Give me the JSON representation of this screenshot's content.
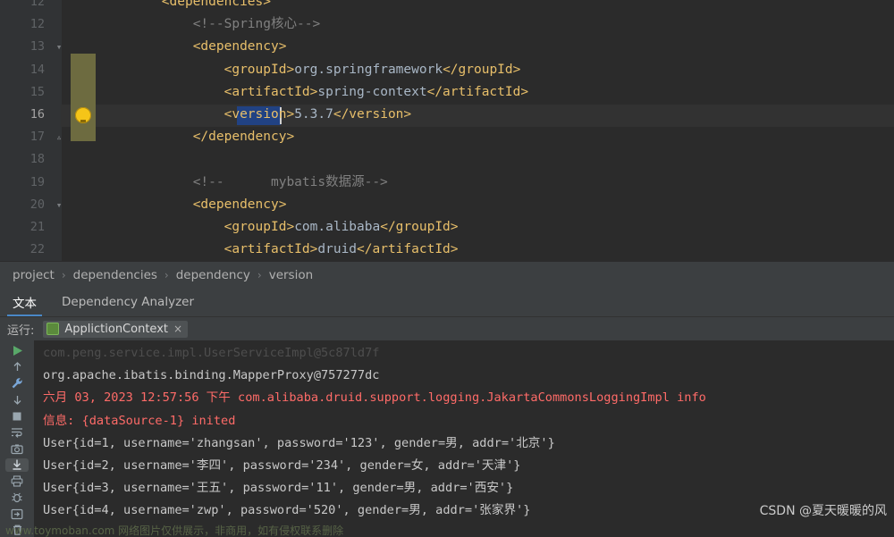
{
  "editor": {
    "lines": [
      {
        "num": "12",
        "fold": "",
        "indent": 12,
        "tokens": [
          {
            "t": "tag",
            "v": "&lt;dependencies&gt;"
          }
        ],
        "current": false
      },
      {
        "num": "12",
        "fold": "",
        "indent": 16,
        "tokens": [
          {
            "t": "cmt",
            "v": "&lt;!--Spring核心--&gt;"
          }
        ],
        "current": false
      },
      {
        "num": "13",
        "fold": "v",
        "indent": 16,
        "tokens": [
          {
            "t": "tag",
            "v": "&lt;dependency&gt;"
          }
        ],
        "current": false
      },
      {
        "num": "14",
        "fold": "",
        "indent": 20,
        "tokens": [
          {
            "t": "tag",
            "v": "&lt;groupId&gt;"
          },
          {
            "t": "txt",
            "v": "org.springframework"
          },
          {
            "t": "tag",
            "v": "&lt;/groupId&gt;"
          }
        ],
        "current": false
      },
      {
        "num": "15",
        "fold": "",
        "indent": 20,
        "tokens": [
          {
            "t": "tag",
            "v": "&lt;artifactId&gt;"
          },
          {
            "t": "txt",
            "v": "spring-context"
          },
          {
            "t": "tag",
            "v": "&lt;/artifactId&gt;"
          }
        ],
        "current": false
      },
      {
        "num": "16",
        "fold": "",
        "indent": 20,
        "tokens": [
          {
            "t": "tag",
            "v": "&lt;version&gt;"
          },
          {
            "t": "txt",
            "v": "5.3.7"
          },
          {
            "t": "tag",
            "v": "&lt;/version&gt;"
          }
        ],
        "current": true
      },
      {
        "num": "17",
        "fold": "^",
        "indent": 16,
        "tokens": [
          {
            "t": "tag",
            "v": "&lt;/dependency&gt;"
          }
        ],
        "current": false
      },
      {
        "num": "18",
        "fold": "",
        "indent": 0,
        "tokens": [],
        "current": false
      },
      {
        "num": "19",
        "fold": "",
        "indent": 16,
        "tokens": [
          {
            "t": "cmt",
            "v": "&lt;!--      mybatis数据源--&gt;"
          }
        ],
        "current": false
      },
      {
        "num": "20",
        "fold": "v",
        "indent": 16,
        "tokens": [
          {
            "t": "tag",
            "v": "&lt;dependency&gt;"
          }
        ],
        "current": false
      },
      {
        "num": "21",
        "fold": "",
        "indent": 20,
        "tokens": [
          {
            "t": "tag",
            "v": "&lt;groupId&gt;"
          },
          {
            "t": "txt",
            "v": "com.alibaba"
          },
          {
            "t": "tag",
            "v": "&lt;/groupId&gt;"
          }
        ],
        "current": false
      },
      {
        "num": "22",
        "fold": "",
        "indent": 20,
        "tokens": [
          {
            "t": "tag",
            "v": "&lt;artifactId&gt;"
          },
          {
            "t": "txt",
            "v": "druid"
          },
          {
            "t": "tag",
            "v": "&lt;/artifactId&gt;"
          }
        ],
        "current": false
      }
    ],
    "intention_bulb": "lightbulb-icon",
    "accent_caret": "#d0d0d0"
  },
  "breadcrumb": {
    "items": [
      "project",
      "dependencies",
      "dependency",
      "version"
    ],
    "separator": "›"
  },
  "tool_tabs": [
    {
      "label": "文本",
      "active": true
    },
    {
      "label": "Dependency Analyzer",
      "active": false
    }
  ],
  "run_panel": {
    "label": "运行:",
    "config_name": "ApplictionContext",
    "close_label": "×",
    "sidebar_buttons": [
      {
        "name": "run-button",
        "glyph": "▶"
      },
      {
        "name": "scroll-up-button",
        "glyph": "↑"
      },
      {
        "name": "settings-wrench-button",
        "glyph": "🔧"
      },
      {
        "name": "scroll-down-button",
        "glyph": "↓"
      },
      {
        "name": "stop-button",
        "glyph": "■"
      },
      {
        "name": "soft-wrap-button",
        "glyph": "≡"
      },
      {
        "name": "screenshot-button",
        "glyph": "▣"
      },
      {
        "name": "scroll-to-end-button",
        "glyph": "⤓"
      },
      {
        "name": "print-button",
        "glyph": "🖨"
      },
      {
        "name": "bug-button",
        "glyph": "✳"
      },
      {
        "name": "export-button",
        "glyph": "⇥"
      },
      {
        "name": "clear-all-button",
        "glyph": "🗑"
      }
    ],
    "console_lines": [
      {
        "style": "dim",
        "text": "com.peng.service.impl.UserServiceImpl@5c87ld7f"
      },
      {
        "style": "white",
        "text": "org.apache.ibatis.binding.MapperProxy@757277dc"
      },
      {
        "style": "red",
        "text": "六月 03, 2023 12:57:56 下午 com.alibaba.druid.support.logging.JakartaCommonsLoggingImpl info"
      },
      {
        "style": "red",
        "text": "信息: {dataSource-1} inited"
      },
      {
        "style": "white",
        "text": "User{id=1, username='zhangsan', password='123', gender=男, addr='北京'}"
      },
      {
        "style": "white",
        "text": "User{id=2, username='李四', password='234', gender=女, addr='天津'}"
      },
      {
        "style": "white",
        "text": "User{id=3, username='王五', password='11', gender=男, addr='西安'}"
      },
      {
        "style": "white",
        "text": "User{id=4, username='zwp', password='520', gender=男, addr='张家界'}"
      }
    ]
  },
  "watermarks": {
    "main": "CSDN @夏天暖暖的风",
    "footer": "www.toymoban.com 网络图片仅供展示，非商用，如有侵权联系删除"
  },
  "colors": {
    "editor_bg": "#2b2b2b",
    "gutter_bg": "#313335",
    "panel_bg": "#3c3f41",
    "tag": "#e8bf6a",
    "comment": "#808080",
    "text": "#a9b7c6",
    "error_red": "#ff6b68",
    "tab_underline": "#4a88c7",
    "changed_band": "#6d6b40"
  }
}
